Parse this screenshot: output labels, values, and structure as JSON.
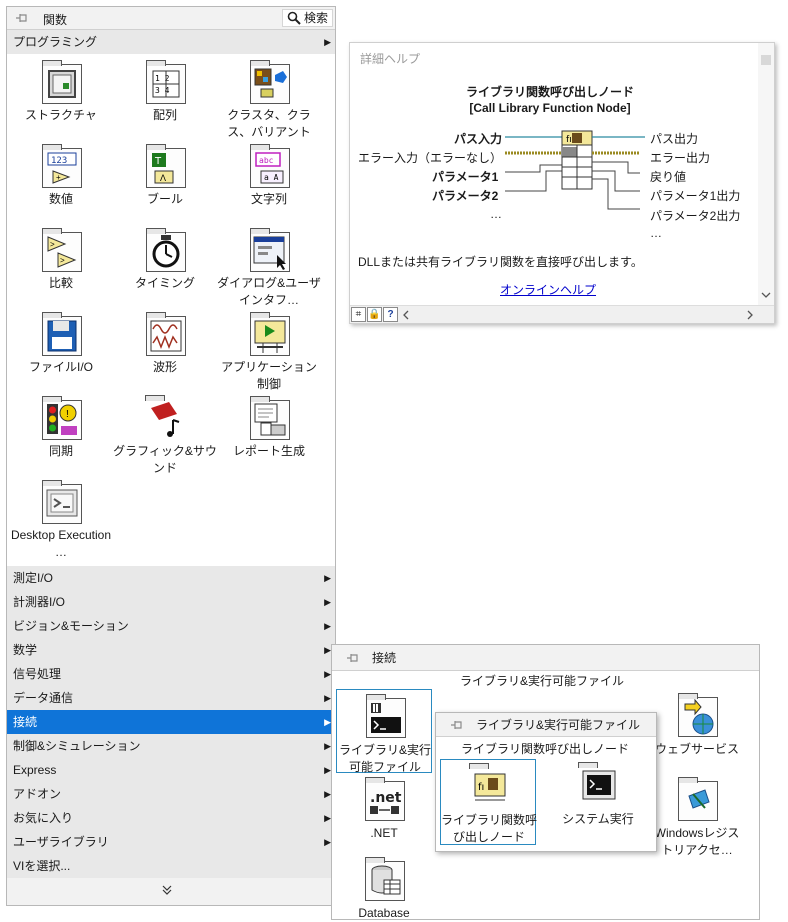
{
  "palette": {
    "title": "関数",
    "search_label": "検索",
    "open_category": "プログラミング",
    "tiles": [
      {
        "label": "ストラクチャ"
      },
      {
        "label": "配列"
      },
      {
        "label": "クラスタ、クラス、バリアント"
      },
      {
        "label": "数値"
      },
      {
        "label": "ブール"
      },
      {
        "label": "文字列"
      },
      {
        "label": "比較"
      },
      {
        "label": "タイミング"
      },
      {
        "label": "ダイアログ&ユーザインタフ…"
      },
      {
        "label": "ファイルI/O"
      },
      {
        "label": "波形"
      },
      {
        "label": "アプリケーション制御"
      },
      {
        "label": "同期"
      },
      {
        "label": "グラフィック&サウンド"
      },
      {
        "label": "レポート生成"
      },
      {
        "label": "Desktop Execution …"
      }
    ],
    "categories": [
      {
        "label": "測定I/O",
        "has_submenu": true
      },
      {
        "label": "計測器I/O",
        "has_submenu": true
      },
      {
        "label": "ビジョン&モーション",
        "has_submenu": true
      },
      {
        "label": "数学",
        "has_submenu": true
      },
      {
        "label": "信号処理",
        "has_submenu": true
      },
      {
        "label": "データ通信",
        "has_submenu": true
      },
      {
        "label": "接続",
        "has_submenu": true,
        "selected": true
      },
      {
        "label": "制御&シミュレーション",
        "has_submenu": true
      },
      {
        "label": "Express",
        "has_submenu": true
      },
      {
        "label": "アドオン",
        "has_submenu": true
      },
      {
        "label": "お気に入り",
        "has_submenu": true
      },
      {
        "label": "ユーザライブラリ",
        "has_submenu": true
      },
      {
        "label": "VIを選択...",
        "has_submenu": false
      }
    ],
    "selected_color": "#0f74d8"
  },
  "help": {
    "title": "詳細ヘルプ",
    "node_name_ja": "ライブラリ関数呼び出しノード",
    "node_name_en": "[Call Library Function Node]",
    "left_terms": [
      "パス入力",
      "エラー入力（エラーなし）",
      "パラメータ1",
      "パラメータ2",
      "…"
    ],
    "right_terms": [
      "パス出力",
      "エラー出力",
      "戻り値",
      "パラメータ1出力",
      "パラメータ2出力",
      "…"
    ],
    "description": "DLLまたは共有ライブラリ関数を直接呼び出します。",
    "link": "オンラインヘルプ"
  },
  "connectivity": {
    "title": "接続",
    "tiles": [
      {
        "label": "ライブラリ&実行可能ファイル"
      },
      {
        "label": ".NET"
      },
      {
        "label": "Database"
      },
      {
        "label": "ウェブサービス"
      },
      {
        "label": "Windowsレジストリアクセ…"
      }
    ],
    "hover_caption": "ライブラリ&実行可能ファイル"
  },
  "library": {
    "title": "ライブラリ&実行可能ファイル",
    "hover_caption": "ライブラリ関数呼び出しノード",
    "tiles": [
      {
        "label": "ライブラリ関数呼び出しノード"
      },
      {
        "label": "システム実行"
      }
    ]
  }
}
